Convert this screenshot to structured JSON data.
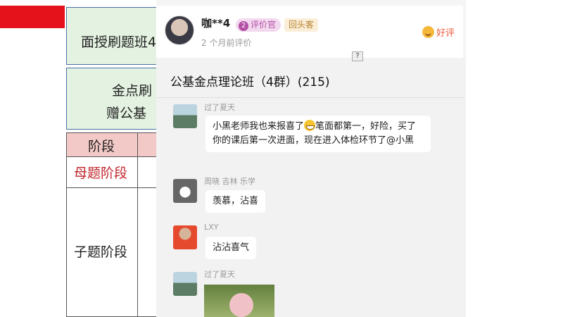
{
  "background_doc": {
    "box1_text": "面授刷题班4",
    "box2_line1": "金点刷",
    "box2_line2": "赠公基",
    "table": {
      "header": "阶段",
      "row1_label": "母题阶段",
      "row2_label": "子题阶段"
    }
  },
  "review": {
    "username": "咖**4",
    "evaluator_level": "2",
    "evaluator_label": "评价官",
    "repeat_customer_label": "回头客",
    "time_ago": "2 个月前评价",
    "rating_label": "好评"
  },
  "chat_screenshot": {
    "help_mark": "?",
    "group_title": "公基金点理论班（4群）(215)",
    "messages": [
      {
        "sender": "过了夏天",
        "text_before_emoji": "小黑老师我也来报喜了",
        "text_after_emoji": "笔面都第一，好险，买了你的课后第一次进面，现在进入体检环节了@小黑"
      },
      {
        "sender": "周晓  吉林 乐学",
        "text": "羡慕，沾喜"
      },
      {
        "sender": "LXY",
        "text": "沾沾喜气"
      },
      {
        "sender": "过了夏天",
        "text": ""
      }
    ]
  }
}
